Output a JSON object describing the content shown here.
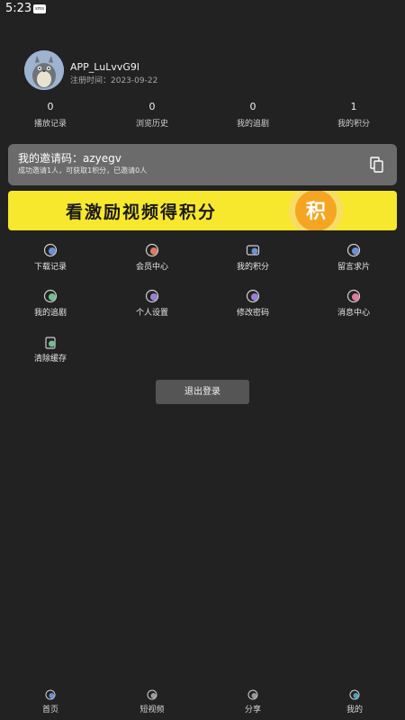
{
  "status": {
    "time": "5:23",
    "badge": "sms"
  },
  "profile": {
    "username": "APP_LuLvvG9l",
    "reg_date": "注册时间：2023-09-22"
  },
  "stats": [
    {
      "value": "0",
      "label": "播放记录"
    },
    {
      "value": "0",
      "label": "浏览历史"
    },
    {
      "value": "0",
      "label": "我的追剧"
    },
    {
      "value": "1",
      "label": "我的积分"
    }
  ],
  "invite": {
    "code_text": "我的邀请码：azyegv",
    "desc": "成功邀请1人，可获取1积分，已邀请0人"
  },
  "banner": {
    "text": "看激励视频得积分",
    "coin_char": "积"
  },
  "menu": [
    {
      "label": "下载记录"
    },
    {
      "label": "会员中心"
    },
    {
      "label": "我的积分"
    },
    {
      "label": "留言求片"
    },
    {
      "label": "我的追剧"
    },
    {
      "label": "个人设置"
    },
    {
      "label": "修改密码"
    },
    {
      "label": "消息中心"
    },
    {
      "label": "清除缓存"
    }
  ],
  "logout_label": "退出登录",
  "nav": [
    {
      "label": "首页"
    },
    {
      "label": "短视频"
    },
    {
      "label": "分享"
    },
    {
      "label": "我的"
    }
  ],
  "colors": {
    "background": "#222222",
    "banner_yellow": "#f7e82d",
    "coin_orange": "#f4a622",
    "invite_card": "#6b6b6b"
  }
}
